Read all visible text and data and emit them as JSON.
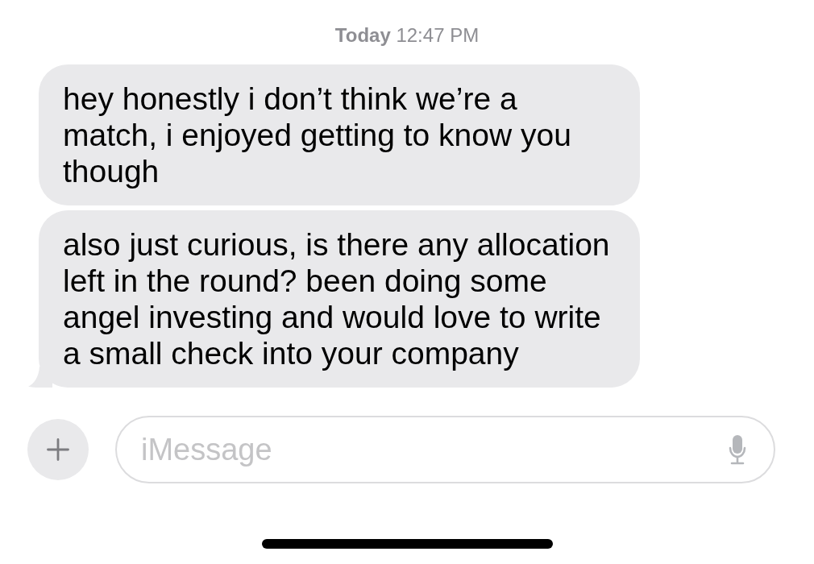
{
  "timestamp": "**Today** 12:47 PM",
  "messages": [
    {
      "kind": "received",
      "tail": false,
      "text": "hey honestly i don’t think we’re a match, i enjoyed getting to know you though"
    },
    {
      "kind": "received",
      "tail": true,
      "text": "also just curious, is there any allocation left in the round? been doing some angel investing and would love to write a small check into your company"
    }
  ],
  "composer": {
    "placeholder": "iMessage"
  }
}
